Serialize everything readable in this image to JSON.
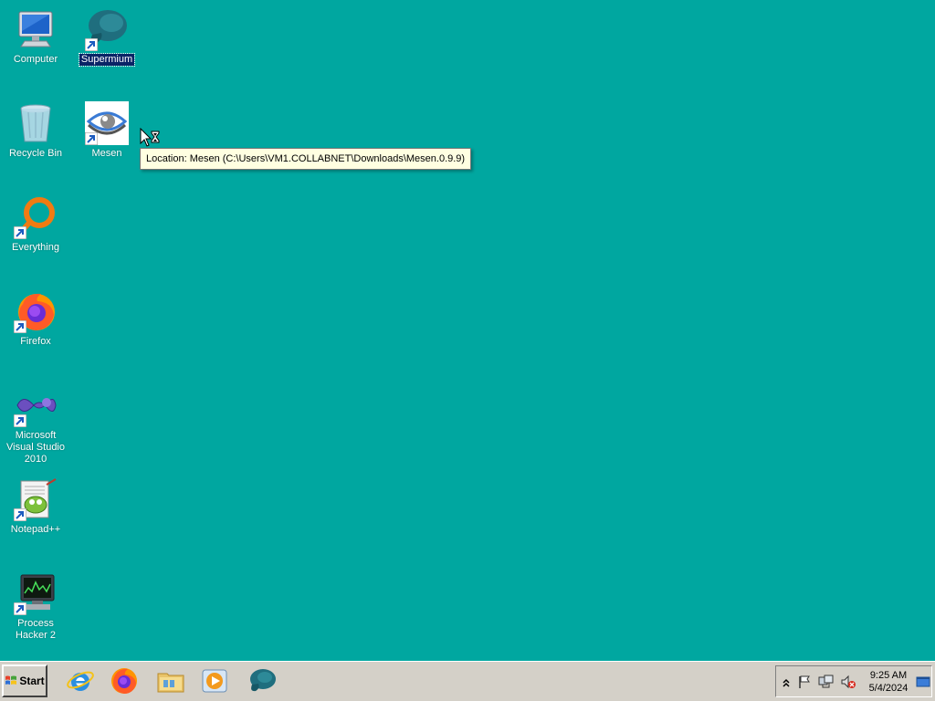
{
  "desktop": {
    "background": "#00a7a0",
    "icons": [
      {
        "label": "Computer",
        "icon": "computer-icon",
        "shortcut": false,
        "selected": false
      },
      {
        "label": "Supermium",
        "icon": "supermium-icon",
        "shortcut": true,
        "selected": true
      },
      {
        "label": "Recycle Bin",
        "icon": "recycle-bin-icon",
        "shortcut": false,
        "selected": false
      },
      {
        "label": "Mesen",
        "icon": "mesen-icon",
        "shortcut": true,
        "selected": false
      },
      {
        "label": "Everything",
        "icon": "everything-icon",
        "shortcut": true,
        "selected": false
      },
      {
        "label": "Firefox",
        "icon": "firefox-icon",
        "shortcut": true,
        "selected": false
      },
      {
        "label": "Microsoft Visual Studio 2010",
        "icon": "visual-studio-icon",
        "shortcut": true,
        "selected": false
      },
      {
        "label": "Notepad++",
        "icon": "notepadpp-icon",
        "shortcut": true,
        "selected": false
      },
      {
        "label": "Process Hacker 2",
        "icon": "process-hacker-icon",
        "shortcut": true,
        "selected": false
      }
    ]
  },
  "tooltip": {
    "text": "Location: Mesen (C:\\Users\\VM1.COLLABNET\\Downloads\\Mesen.0.9.9)"
  },
  "taskbar": {
    "start_label": "Start",
    "quick_launch": [
      {
        "icon": "internet-explorer-icon"
      },
      {
        "icon": "firefox-icon"
      },
      {
        "icon": "file-explorer-icon"
      },
      {
        "icon": "media-player-icon"
      },
      {
        "icon": "supermium-icon"
      }
    ],
    "tray": {
      "icons": [
        "show-hidden-icons-chevron-icon",
        "action-center-flag-icon",
        "network-icon",
        "volume-muted-icon"
      ],
      "time": "9:25 AM",
      "date": "5/4/2024",
      "show_desktop_icon": "show-desktop-icon"
    }
  }
}
